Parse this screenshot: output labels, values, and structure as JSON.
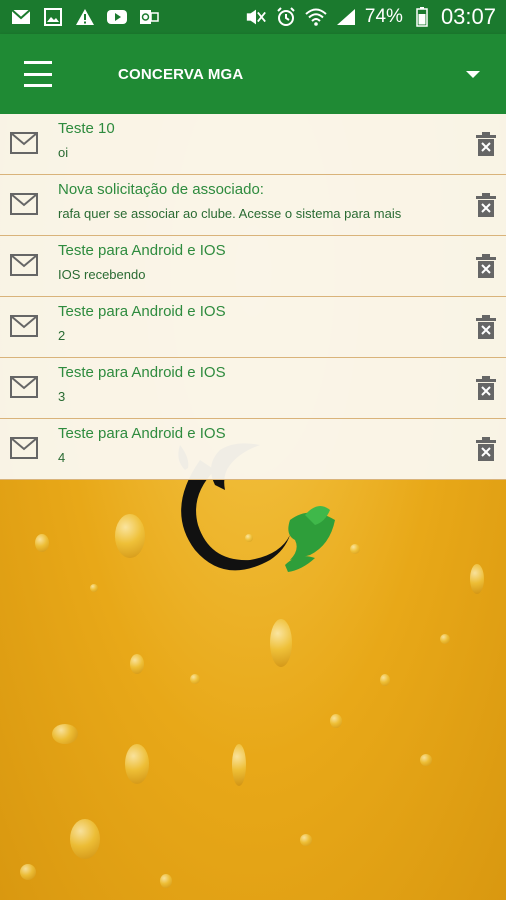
{
  "status_bar": {
    "battery": "74%",
    "time": "03:07"
  },
  "app_bar": {
    "title": "CONCERVA MGA"
  },
  "messages": [
    {
      "title": "Teste 10",
      "body": "oi"
    },
    {
      "title": "Nova solicitação de associado:",
      "body": "rafa quer se associar ao clube. Acesse o sistema para mais"
    },
    {
      "title": "Teste para Android e IOS",
      "body": "IOS recebendo"
    },
    {
      "title": "Teste para Android e IOS",
      "body": "2"
    },
    {
      "title": "Teste para Android e IOS",
      "body": "3"
    },
    {
      "title": "Teste para Android e IOS",
      "body": "4"
    }
  ],
  "colors": {
    "app_bar": "#1f8a34",
    "status_bar": "#1b7a2e",
    "message_text": "#2e8b3e",
    "background": "#e8a818"
  },
  "icons": [
    "gmail-icon",
    "gallery-icon",
    "warning-icon",
    "youtube-icon",
    "outlook-icon",
    "mute-icon",
    "alarm-icon",
    "wifi-icon",
    "signal-icon",
    "battery-icon",
    "menu-icon",
    "dropdown-icon",
    "mail-icon",
    "trash-icon"
  ]
}
